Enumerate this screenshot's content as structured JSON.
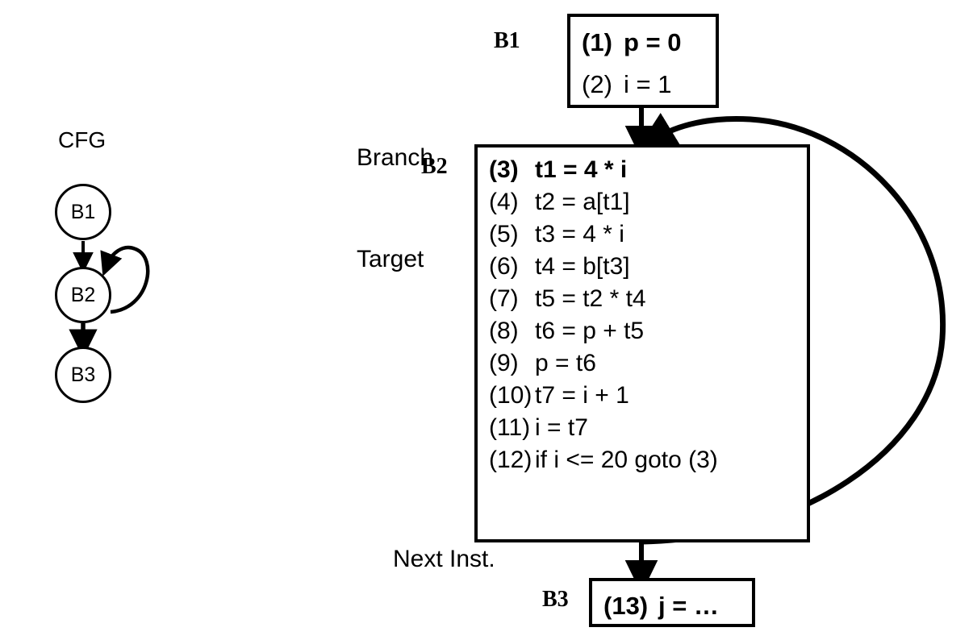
{
  "diagram": {
    "cfg": {
      "title": "CFG",
      "nodes": [
        {
          "id": "B1",
          "label": "B1"
        },
        {
          "id": "B2",
          "label": "B2"
        },
        {
          "id": "B3",
          "label": "B3"
        }
      ],
      "edges": [
        {
          "from": "B1",
          "to": "B2",
          "kind": "fallthrough"
        },
        {
          "from": "B2",
          "to": "B2",
          "kind": "self-loop"
        },
        {
          "from": "B2",
          "to": "B3",
          "kind": "fallthrough"
        }
      ]
    },
    "annotations": {
      "branch_target": "Branch\nTarget",
      "branch_target_line1": "Branch",
      "branch_target_line2": "Target",
      "next_inst": "Next Inst."
    },
    "blocks": [
      {
        "id": "B1",
        "label": "B1",
        "lines": [
          {
            "num": "(1)",
            "text": "p = 0",
            "bold": true
          },
          {
            "num": "(2)",
            "text": "i = 1",
            "bold": false
          }
        ]
      },
      {
        "id": "B2",
        "label": "B2",
        "lines": [
          {
            "num": "(3)",
            "text": "t1 = 4 * i",
            "bold": true
          },
          {
            "num": "(4)",
            "text": "t2 = a[t1]",
            "bold": false
          },
          {
            "num": "(5)",
            "text": "t3 = 4 * i",
            "bold": false
          },
          {
            "num": "(6)",
            "text": "t4 = b[t3]",
            "bold": false
          },
          {
            "num": "(7)",
            "text": "t5 = t2 * t4",
            "bold": false
          },
          {
            "num": "(8)",
            "text": "t6 = p + t5",
            "bold": false
          },
          {
            "num": "(9)",
            "text": "p = t6",
            "bold": false
          },
          {
            "num": "(10)",
            "text": "t7 = i + 1",
            "bold": false
          },
          {
            "num": "(11)",
            "text": "i = t7",
            "bold": false
          },
          {
            "num": "(12)",
            "text": "if i <= 20 goto (3)",
            "bold": false
          }
        ]
      },
      {
        "id": "B3",
        "label": "B3",
        "lines": [
          {
            "num": "(13)",
            "text": "j = …",
            "bold": true
          }
        ]
      }
    ],
    "colors": {
      "ink": "#000000",
      "background": "#ffffff"
    }
  }
}
